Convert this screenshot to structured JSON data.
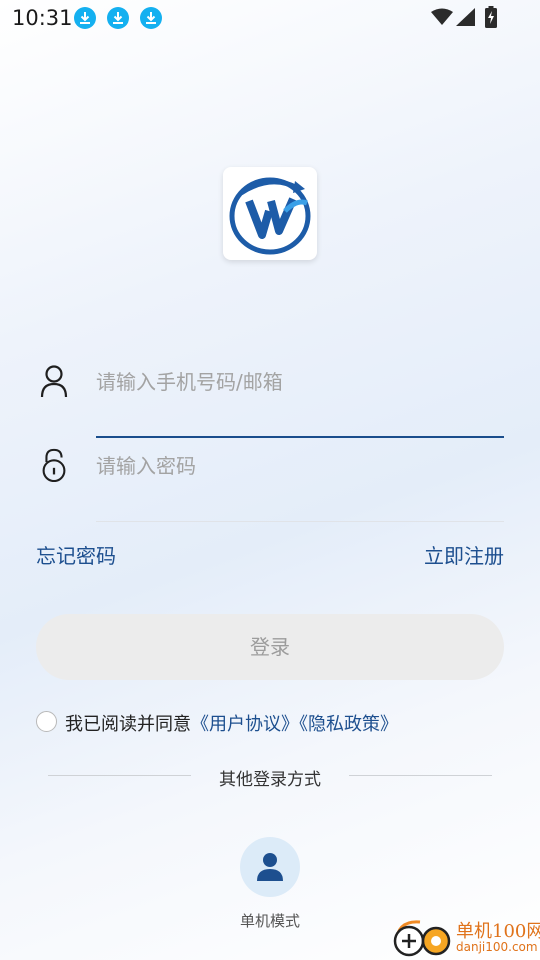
{
  "status_bar": {
    "time": "10:31",
    "notification_icons": [
      "download-icon",
      "download-icon",
      "download-icon"
    ],
    "system_icons": [
      "wifi-icon",
      "signal-icon",
      "battery-charging-icon"
    ]
  },
  "brand": {
    "logo_icon": "app-logo-icon",
    "primary_color": "#1d4f8f"
  },
  "form": {
    "account": {
      "placeholder": "请输入手机号码/邮箱",
      "value": "",
      "icon": "user-icon"
    },
    "password": {
      "placeholder": "请输入密码",
      "value": "",
      "icon": "lock-icon"
    }
  },
  "links": {
    "forgot": "忘记密码",
    "register": "立即注册"
  },
  "login_button": {
    "label": "登录",
    "background": "#ececec",
    "text_color": "#9c9c9c"
  },
  "agreement": {
    "prefix": "我已阅读并同意",
    "user_agreement": "《用户协议》",
    "privacy_policy": "《隐私政策》",
    "checked": false
  },
  "other_login": {
    "title": "其他登录方式",
    "options": [
      {
        "label": "单机模式",
        "icon": "person-icon"
      }
    ]
  },
  "watermark": {
    "name": "单机100网",
    "url": "danji100.com",
    "icon": "danji100-logo-icon"
  }
}
